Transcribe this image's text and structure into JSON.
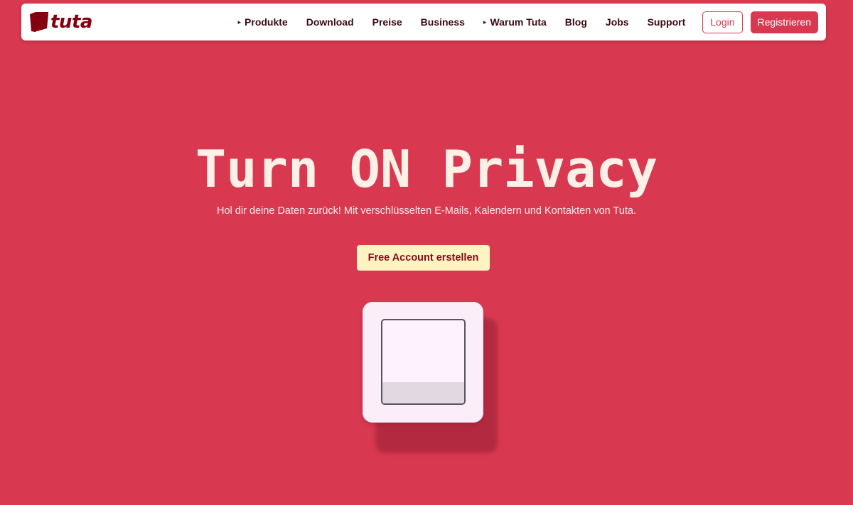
{
  "brand": {
    "name": "tuta",
    "color": "#840010"
  },
  "nav": {
    "items": [
      {
        "label": "Produkte",
        "has_dropdown": true
      },
      {
        "label": "Download",
        "has_dropdown": false
      },
      {
        "label": "Preise",
        "has_dropdown": false
      },
      {
        "label": "Business",
        "has_dropdown": false
      },
      {
        "label": "Warum Tuta",
        "has_dropdown": true
      },
      {
        "label": "Blog",
        "has_dropdown": false
      },
      {
        "label": "Jobs",
        "has_dropdown": false
      },
      {
        "label": "Support",
        "has_dropdown": false
      }
    ],
    "dropdown_glyph": "▸",
    "login_label": "Login",
    "register_label": "Registrieren"
  },
  "hero": {
    "title": "Turn ON Privacy",
    "subtitle": "Hol dir deine Daten zurück! Mit verschlüsselten E-Mails, Kalendern und Kontakten von Tuta.",
    "cta_label": "Free Account erstellen"
  },
  "colors": {
    "background": "#d93950",
    "accent": "#d93950",
    "cta_background": "#fef4c2",
    "cta_text": "#850a1b",
    "title_text": "#fdf0e6"
  },
  "illustration": {
    "name": "light-switch-icon",
    "state": "on"
  }
}
